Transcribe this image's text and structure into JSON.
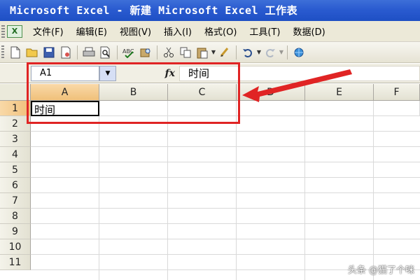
{
  "window": {
    "title": "Microsoft Excel - 新建 Microsoft Excel 工作表"
  },
  "menu": {
    "app_icon": "excel-icon",
    "items": [
      {
        "label": "文件(F)"
      },
      {
        "label": "编辑(E)"
      },
      {
        "label": "视图(V)"
      },
      {
        "label": "插入(I)"
      },
      {
        "label": "格式(O)"
      },
      {
        "label": "工具(T)"
      },
      {
        "label": "数据(D)"
      }
    ]
  },
  "toolbar": {
    "icons": [
      "new-icon",
      "open-icon",
      "save-icon",
      "permission-icon",
      "print-icon",
      "print-preview-icon",
      "spelling-icon",
      "research-icon",
      "cut-icon",
      "copy-icon",
      "paste-icon",
      "format-painter-icon",
      "undo-icon",
      "redo-icon",
      "hyperlink-icon"
    ]
  },
  "formula_bar": {
    "name_box": "A1",
    "fx_label": "fx",
    "content": "时间"
  },
  "sheet": {
    "columns": [
      "A",
      "B",
      "C",
      "D",
      "E",
      "F"
    ],
    "rows": [
      "1",
      "2",
      "3",
      "4",
      "5",
      "6",
      "7",
      "8",
      "9",
      "10",
      "11"
    ],
    "cells": {
      "A1": "时间"
    },
    "active_cell": "A1"
  },
  "annotation": {
    "box_color": "#e02424",
    "arrow_color": "#e02424"
  },
  "watermark": "头条 @猫了个咪"
}
